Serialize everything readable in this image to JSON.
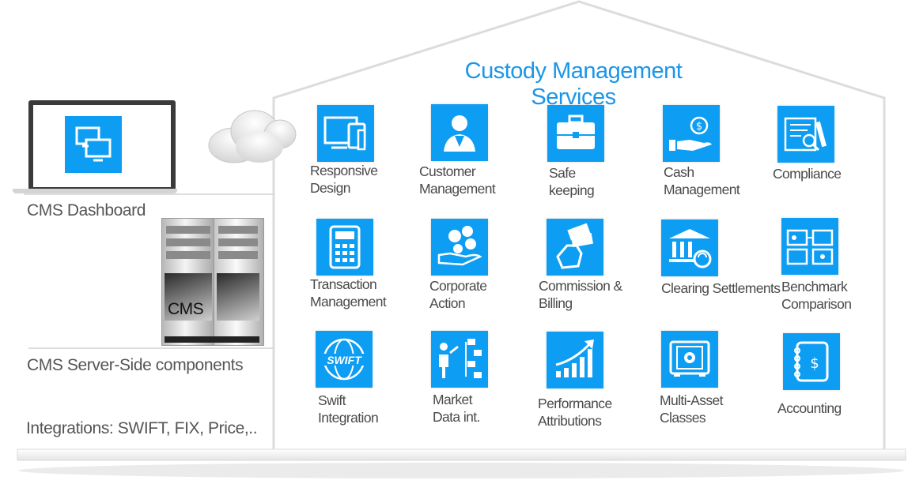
{
  "title": "Custody Management Services",
  "left": {
    "dashboard_label": "CMS Dashboard",
    "server_label": "CMS Server-Side  components",
    "server_box_text": "CMS",
    "integrations_label": "Integrations: SWIFT, FIX, Price,.."
  },
  "services": [
    {
      "label": "Responsive\nDesign",
      "icon": "responsive-design-icon"
    },
    {
      "label": "Customer\nManagement",
      "icon": "customer-icon"
    },
    {
      "label": "Safe\nkeeping",
      "icon": "briefcase-icon"
    },
    {
      "label": "Cash\nManagement",
      "icon": "cash-hand-icon"
    },
    {
      "label": "Compliance",
      "icon": "compliance-icon"
    },
    {
      "label": "Transaction\nManagement",
      "icon": "calculator-icon"
    },
    {
      "label": "Corporate\nAction",
      "icon": "currency-hand-icon"
    },
    {
      "label": "Commission &\nBilling",
      "icon": "money-hand-icon"
    },
    {
      "label": "Clearing Settlements",
      "icon": "bank-icon"
    },
    {
      "label": "Benchmark\nComparison",
      "icon": "benchmark-icon"
    },
    {
      "label": "Swift\nIntegration",
      "icon": "swift-icon"
    },
    {
      "label": "Market\nData int.",
      "icon": "market-data-icon"
    },
    {
      "label": "Performance\nAttributions",
      "icon": "growth-chart-icon"
    },
    {
      "label": "Multi-Asset\nClasses",
      "icon": "vault-icon"
    },
    {
      "label": "Accounting",
      "icon": "accounting-icon"
    }
  ],
  "swift_text": "SWIFT",
  "colors": {
    "accent": "#0d9df2",
    "title": "#1a96e8",
    "text": "#4a4a4a"
  }
}
